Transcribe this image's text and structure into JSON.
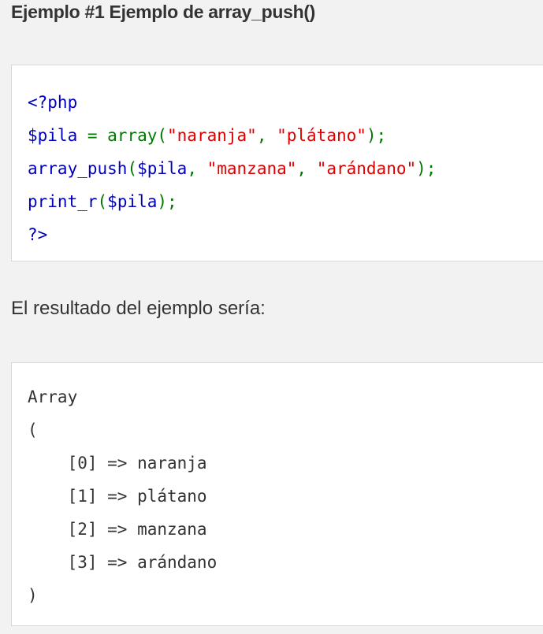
{
  "heading": "Ejemplo #1 Ejemplo de array_push()",
  "code_lines": [
    [
      {
        "t": "<?php",
        "c": "b"
      }
    ],
    [
      {
        "t": "$pila ",
        "c": "b"
      },
      {
        "t": "= ",
        "c": "g"
      },
      {
        "t": "array(",
        "c": "g"
      },
      {
        "t": "\"naranja\"",
        "c": "r"
      },
      {
        "t": ", ",
        "c": "g"
      },
      {
        "t": "\"plátano\"",
        "c": "r"
      },
      {
        "t": ");",
        "c": "g"
      }
    ],
    [
      {
        "t": "array_push",
        "c": "b"
      },
      {
        "t": "(",
        "c": "g"
      },
      {
        "t": "$pila",
        "c": "b"
      },
      {
        "t": ", ",
        "c": "g"
      },
      {
        "t": "\"manzana\"",
        "c": "r"
      },
      {
        "t": ", ",
        "c": "g"
      },
      {
        "t": "\"arándano\"",
        "c": "r"
      },
      {
        "t": ");",
        "c": "g"
      }
    ],
    [
      {
        "t": "print_r",
        "c": "b"
      },
      {
        "t": "(",
        "c": "g"
      },
      {
        "t": "$pila",
        "c": "b"
      },
      {
        "t": ");",
        "c": "g"
      }
    ],
    [
      {
        "t": "?>",
        "c": "b"
      }
    ]
  ],
  "result_label": "El resultado del ejemplo sería:",
  "output_lines": [
    "Array",
    "(",
    "    [0] => naranja",
    "    [1] => plátano",
    "    [2] => manzana",
    "    [3] => arándano",
    ")"
  ],
  "colors": {
    "keyword": "#0000BB",
    "operator": "#007700",
    "string": "#DD0000"
  }
}
